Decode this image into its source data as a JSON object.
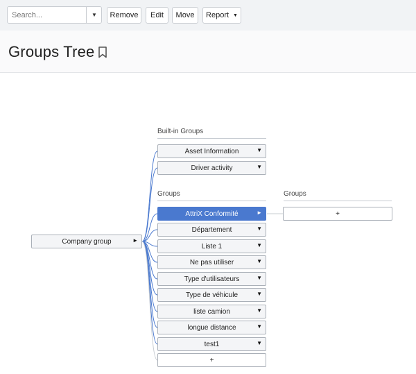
{
  "toolbar": {
    "search_placeholder": "Search...",
    "dropdown_glyph": "▼",
    "remove_label": "Remove",
    "edit_label": "Edit",
    "move_label": "Move",
    "report_label": "Report",
    "caret_glyph": "▼"
  },
  "page": {
    "title": "Groups Tree"
  },
  "tree": {
    "root": {
      "label": "Company group",
      "arrow": "►"
    },
    "builtin_label": "Built-in Groups",
    "builtin_groups": [
      {
        "label": "Asset Information",
        "arrow": "▼"
      },
      {
        "label": "Driver activity",
        "arrow": "▼"
      }
    ],
    "groups_label": "Groups",
    "groups": [
      {
        "label": "AttriX Conformité",
        "arrow": "►",
        "selected": true
      },
      {
        "label": "Département",
        "arrow": "▼"
      },
      {
        "label": "Liste 1",
        "arrow": "▼"
      },
      {
        "label": "Ne pas utiliser",
        "arrow": "▼"
      },
      {
        "label": "Type d'utilisateurs",
        "arrow": "▼"
      },
      {
        "label": "Type de véhicule",
        "arrow": "▼"
      },
      {
        "label": "liste camion",
        "arrow": "▼"
      },
      {
        "label": "longue distance",
        "arrow": "▼"
      },
      {
        "label": "test1",
        "arrow": "▼"
      }
    ],
    "add_label": "+",
    "sub_groups_label": "Groups",
    "sub_add_label": "+",
    "colors": {
      "selected": "#4a79cf",
      "connector": "#4a79cf"
    }
  }
}
